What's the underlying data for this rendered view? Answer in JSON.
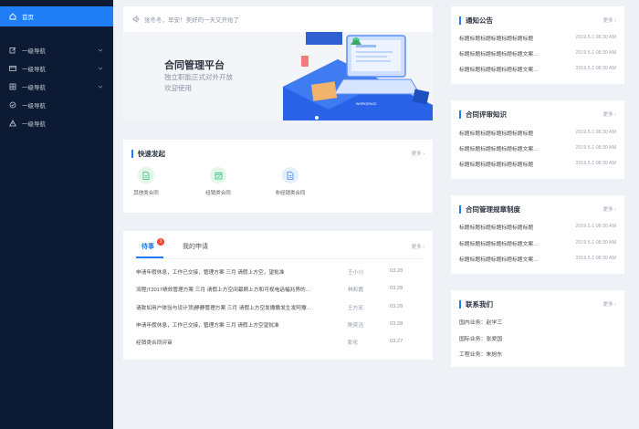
{
  "sidebar": {
    "items": [
      {
        "label": "首页",
        "icon": "home-icon",
        "active": true
      },
      {
        "label": "一级导航",
        "icon": "edit-icon"
      },
      {
        "label": "一级导航",
        "icon": "card-icon"
      },
      {
        "label": "一级导航",
        "icon": "table-icon"
      },
      {
        "label": "一级导航",
        "icon": "check-circle-icon"
      },
      {
        "label": "一级导航",
        "icon": "warning-icon"
      }
    ]
  },
  "hero": {
    "greeting": "张冬冬，早安！美好的一天又开始了",
    "title": "合同管理平台",
    "subtitle_line1": "独立职能正式对外开放",
    "subtitle_line2": "欢迎使用"
  },
  "quick_start": {
    "title": "快速发起",
    "more": "更多",
    "items": [
      {
        "label": "其他类合同",
        "color": "#2bbf6f",
        "bg": "#e3f6ec"
      },
      {
        "label": "经销类合同",
        "color": "#2bbf6f",
        "bg": "#e3f6ec"
      },
      {
        "label": "非经销类合同",
        "color": "#3f86f5",
        "bg": "#e5effe"
      }
    ]
  },
  "tasks": {
    "tab_todo": "待事",
    "badge": "3",
    "tab_mine": "我的申请",
    "more": "更多",
    "rows": [
      {
        "title": "申请年假休息，工作已交接，管理方案 三月 请假上方空，望批准",
        "person": "王小川",
        "date": "03.28"
      },
      {
        "title": "流程|T2017绩效管理方案 三月 请假上方空间幕顾上方和可视电话幅兆界的…",
        "person": "林彩霞",
        "date": "03.28"
      },
      {
        "title": "请款如用户体验与设计顶|静静管理方案 三月 请假上方空发撒撒发生发阿撒…",
        "person": "王方宏",
        "date": "03.28"
      },
      {
        "title": "申请年假休息，工作已交接，管理方案 三月 请假上方空望批准",
        "person": "陈奕迅",
        "date": "03.28"
      },
      {
        "title": "经销类合同评审",
        "person": "彭化",
        "date": "03.27"
      }
    ]
  },
  "notices": {
    "title": "通知公告",
    "more": "更多",
    "rows": [
      {
        "text": "标题标题标题标题标题标题标题",
        "date": "2019.5.1  08:30 AM"
      },
      {
        "text": "标题标题标题标题标题标题文案…",
        "date": "2019.5.1  08:30 AM"
      },
      {
        "text": "标题标题标题标题标题标题文案…",
        "date": "2019.5.1  08:30 AM"
      }
    ]
  },
  "knowledge": {
    "title": "合同评审知识",
    "more": "更多",
    "rows": [
      {
        "text": "标题标题标题标题标题标题标题",
        "date": "2019.5.1  08:30 AM"
      },
      {
        "text": "标题标题标题标题标题标题文案…",
        "date": "2019.5.1  08:30 AM"
      },
      {
        "text": "标题标题标题标题标题标题标题",
        "date": "2019.5.1  08:30 AM"
      }
    ]
  },
  "rules": {
    "title": "合同管理规章制度",
    "more": "更多",
    "rows": [
      {
        "text": "标题标题标题标题标题标题标题",
        "date": "2019.5.1  08:30 AM"
      },
      {
        "text": "标题标题标题标题标题标题文案…",
        "date": "2019.5.1  08:30 AM"
      },
      {
        "text": "标题标题标题标题标题标题文案…",
        "date": "2019.5.1  08:30 AM"
      }
    ]
  },
  "contacts": {
    "title": "联系我们",
    "more": "更多",
    "rows": [
      "国内业务：赵学三",
      "国际业务：张爱国",
      "工程业务：朱旭东"
    ]
  },
  "colors": {
    "accent": "#1f7df5",
    "sidebar": "#0c1a33",
    "badge": "#f5412d"
  }
}
